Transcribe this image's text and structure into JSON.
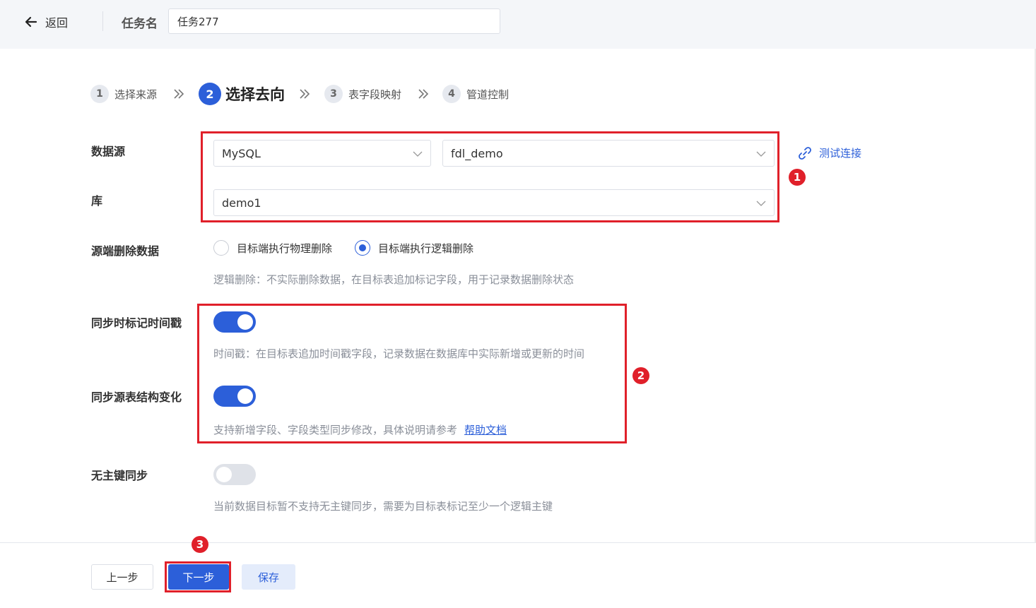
{
  "header": {
    "back_label": "返回",
    "task_label": "任务名",
    "task_value": "任务277"
  },
  "steps": [
    {
      "num": "1",
      "label": "选择来源"
    },
    {
      "num": "2",
      "label": "选择去向"
    },
    {
      "num": "3",
      "label": "表字段映射"
    },
    {
      "num": "4",
      "label": "管道控制"
    }
  ],
  "active_step": 2,
  "form": {
    "datasource_label": "数据源",
    "datasource_type": "MySQL",
    "datasource_conn": "fdl_demo",
    "db_label": "库",
    "db_value": "demo1",
    "test_conn_label": "测试连接",
    "delete_label": "源端删除数据",
    "delete_options": [
      "目标端执行物理删除",
      "目标端执行逻辑删除"
    ],
    "delete_selected": "目标端执行逻辑删除",
    "delete_hint": "逻辑删除：不实际删除数据，在目标表追加标记字段，用于记录数据删除状态",
    "timestamp_label": "同步时标记时间戳",
    "timestamp_on": true,
    "timestamp_hint": "时间戳：在目标表追加时间戳字段，记录数据在数据库中实际新增或更新的时间",
    "schema_label": "同步源表结构变化",
    "schema_on": true,
    "schema_hint": "支持新增字段、字段类型同步修改，具体说明请参考",
    "schema_help_link": "帮助文档",
    "nopk_label": "无主键同步",
    "nopk_on": false,
    "nopk_hint": "当前数据目标暂不支持无主键同步，需要为目标表标记至少一个逻辑主键"
  },
  "annotations": [
    "1",
    "2",
    "3"
  ],
  "footer": {
    "prev_label": "上一步",
    "next_label": "下一步",
    "save_label": "保存"
  },
  "colors": {
    "primary": "#2c5fd9",
    "highlight": "#e0202a",
    "hint_text": "#8a8f99",
    "header_bg": "#f4f6f9"
  }
}
